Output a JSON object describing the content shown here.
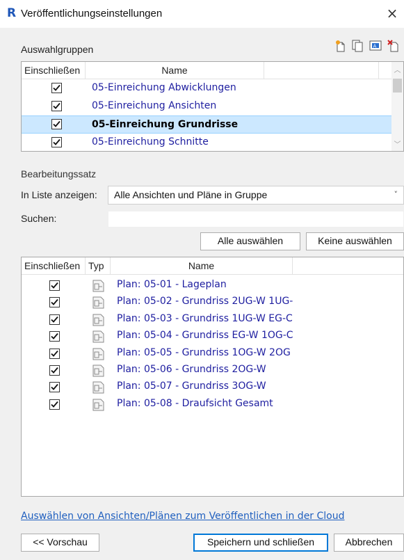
{
  "window": {
    "logo_letter": "R",
    "title": "Veröffentlichungseinstellungen",
    "close_glyph": "×"
  },
  "groups": {
    "label": "Auswahlgruppen",
    "toolbar_icons": [
      "new-set-icon",
      "duplicate-icon",
      "rename-icon",
      "delete-icon"
    ],
    "columns": {
      "include": "Einschließen",
      "name": "Name"
    },
    "rows": [
      {
        "checked": true,
        "name": "05-Einreichung Abwicklungen",
        "selected": false
      },
      {
        "checked": true,
        "name": "05-Einreichung Ansichten",
        "selected": false
      },
      {
        "checked": true,
        "name": "05-Einreichung Grundrisse",
        "selected": true
      },
      {
        "checked": true,
        "name": "05-Einreichung Schnitte",
        "selected": false
      }
    ]
  },
  "edit_set": {
    "label": "Bearbeitungssatz",
    "show_in_list_label": "In Liste anzeigen:",
    "show_in_list_value": "Alle Ansichten und Pläne in Gruppe",
    "search_label": "Suchen:",
    "search_value": "",
    "select_all": "Alle auswählen",
    "select_none": "Keine auswählen"
  },
  "sheets": {
    "columns": {
      "include": "Einschließen",
      "type": "Typ",
      "name": "Name"
    },
    "rows": [
      {
        "checked": true,
        "type_icon": "sheet-icon",
        "name": "Plan: 05-01 - Lageplan"
      },
      {
        "checked": true,
        "type_icon": "sheet-icon",
        "name": "Plan: 05-02 - Grundriss 2UG-W 1UG-"
      },
      {
        "checked": true,
        "type_icon": "sheet-icon",
        "name": "Plan: 05-03 - Grundriss 1UG-W EG-C"
      },
      {
        "checked": true,
        "type_icon": "sheet-icon",
        "name": "Plan: 05-04 - Grundriss EG-W 1OG-C"
      },
      {
        "checked": true,
        "type_icon": "sheet-icon",
        "name": "Plan: 05-05 - Grundriss 1OG-W 2OG"
      },
      {
        "checked": true,
        "type_icon": "sheet-icon",
        "name": "Plan: 05-06 - Grundriss 2OG-W"
      },
      {
        "checked": true,
        "type_icon": "sheet-icon",
        "name": "Plan: 05-07 - Grundriss 3OG-W"
      },
      {
        "checked": true,
        "type_icon": "sheet-icon",
        "name": "Plan: 05-08 - Draufsicht Gesamt"
      }
    ]
  },
  "cloud_link": "Auswählen von Ansichten/Plänen zum Veröffentlichen in der Cloud",
  "footer": {
    "preview": "<< Vorschau",
    "save_close": "Speichern und schließen",
    "cancel": "Abbrechen"
  },
  "colors": {
    "link_blue": "#1e1ea0",
    "selection": "#cce8ff",
    "accent": "#0078d7"
  }
}
